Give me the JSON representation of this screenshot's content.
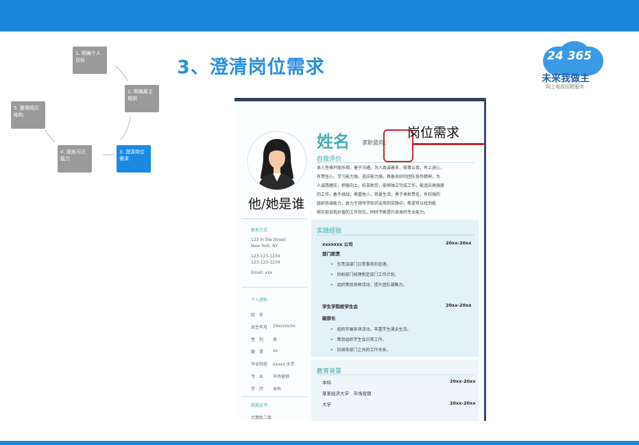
{
  "slide": {
    "title": "3、澄清岗位需求"
  },
  "logo": {
    "number": "24 365",
    "name": "未来我做主",
    "tagline": "网上电视招聘服务"
  },
  "flow": {
    "steps": [
      {
        "label": "1. 明确个人目标"
      },
      {
        "label": "2. 明确雇主规则"
      },
      {
        "label": "3. 澄清岗位需求"
      },
      {
        "label": "4. 提炼可迁能力"
      },
      {
        "label": "5. 整理简历结构"
      }
    ]
  },
  "resume": {
    "name": "姓名",
    "job_intent": "求职意向：",
    "annotation_who": "他/她是谁",
    "annotation_requirement": "岗位需求",
    "self_eval": {
      "title": "自我评价",
      "lines": [
        "本人性格开朗乐观，善于沟通，为人真诚善良，做事认真，有上进心，",
        "有责任心，学习能力强，适应能力强，具备良好的团队协作精神，为",
        "人诚恳踏实，积极向上，吃苦耐劳，能够独立完成工作，能适应高强度",
        "的工作，敢于挑战，尊重他人，热爱生活，勇于承担责任，有较强的",
        "组织协调能力，致力于将所学知识运用到实践中，希望可以找到能",
        "够实现自我价值的工作岗位，同时不断提升自身的专业能力。"
      ]
    },
    "contact": {
      "title": "联系方式",
      "lines": [
        "123 in the Street",
        "New York, NY",
        "123-123-1234",
        "123-123-1234",
        "Email: xxx"
      ]
    },
    "personal": {
      "title": "个人资料",
      "rows": [
        {
          "k": "姓　名",
          "v": ""
        },
        {
          "k": "出生年月",
          "v": "19xx/xx/xx"
        },
        {
          "k": "性　别",
          "v": "男"
        },
        {
          "k": "籍　贯",
          "v": "xx"
        },
        {
          "k": "毕业院校",
          "v": "xxxxx 大学"
        },
        {
          "k": "专　业",
          "v": "市场营销"
        },
        {
          "k": "学　历",
          "v": "本科"
        }
      ]
    },
    "skills": {
      "title": "技能证书",
      "lines": [
        "计算机二级"
      ]
    },
    "experience": {
      "title": "实践经验",
      "jobs": [
        {
          "company": "xxxxxxx 公司",
          "date": "20xx-20xx",
          "role": "部门职责",
          "bullets": [
            "负责该部门日常事务的处理。",
            "协助部门经理制定部门工作计划。",
            "组织策划各种活动，提升团队凝聚力。"
          ]
        },
        {
          "company": "学生学院校学生会",
          "date": "20xx-20xx",
          "role": "副部长",
          "bullets": [
            "组织开展各项活动，丰富学生课余生活。",
            "策划组织学生会日常工作。",
            "协调各部门之间的工作关系。"
          ]
        }
      ]
    },
    "education": {
      "title": "教育背景",
      "rows": [
        {
          "school": "本科",
          "date": "20xx-20xx"
        },
        {
          "school": "某某经济大学　市场营销",
          "date": ""
        },
        {
          "school": "大学",
          "date": "20xx-20xx"
        }
      ]
    }
  }
}
